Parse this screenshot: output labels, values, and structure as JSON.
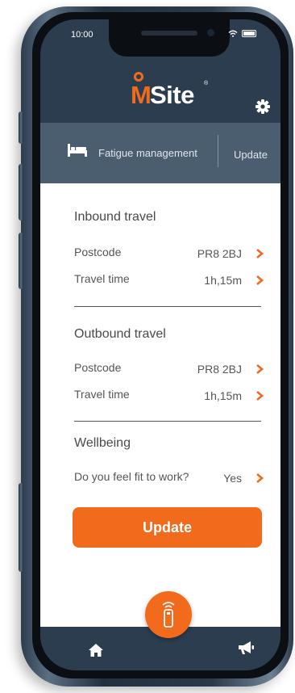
{
  "status_bar": {
    "time": "10:00"
  },
  "brand": {
    "logo_m": "M",
    "logo_site": "Site",
    "logo_reg": "®"
  },
  "header": {
    "section": "Fatigue management",
    "update_link": "Update"
  },
  "inbound": {
    "title": "Inbound travel",
    "rows": [
      {
        "label": "Postcode",
        "value": "PR8 2BJ"
      },
      {
        "label": "Travel time",
        "value": "1h,15m"
      }
    ]
  },
  "outbound": {
    "title": "Outbound travel",
    "rows": [
      {
        "label": "Postcode",
        "value": "PR8 2BJ"
      },
      {
        "label": "Travel time",
        "value": "1h,15m"
      }
    ]
  },
  "wellbeing": {
    "title": "Wellbeing",
    "question": "Do you feel fit to work?",
    "answer": "Yes"
  },
  "actions": {
    "update_button": "Update"
  },
  "colors": {
    "accent": "#f26a1b",
    "header_bg": "#2b3d4f",
    "band_bg": "#4a5e70"
  },
  "icons": {
    "settings": "gear-icon",
    "fatigue": "bed-icon",
    "home": "home-icon",
    "announcements": "megaphone-icon",
    "center_action": "remote-device-icon",
    "row_action": "chevron-right-icon"
  }
}
